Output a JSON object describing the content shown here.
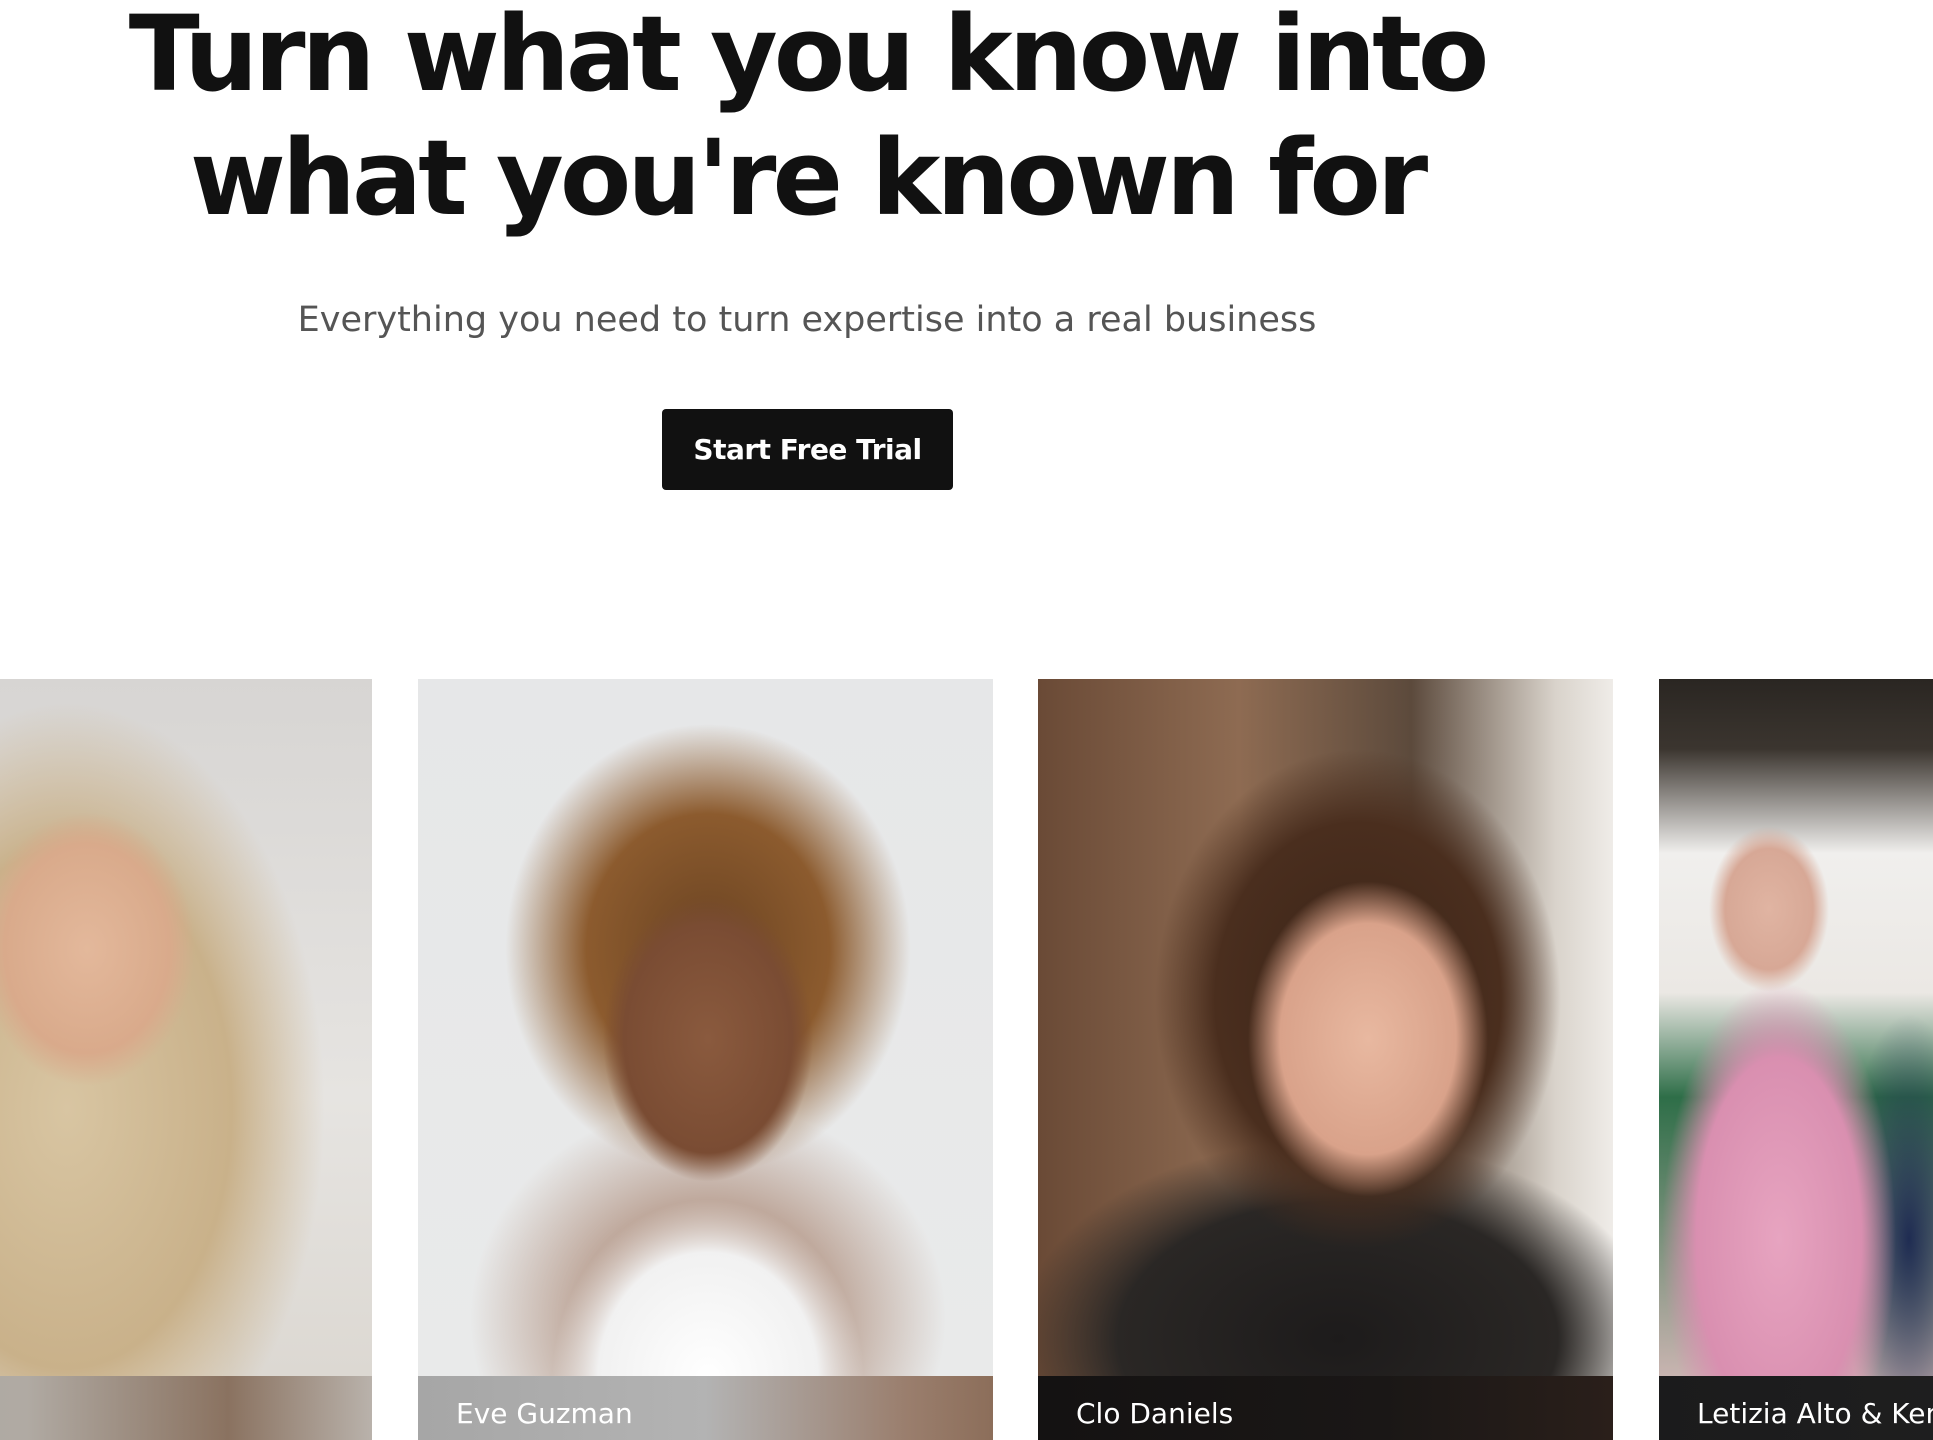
{
  "hero": {
    "title_line_1": "Turn what you know into",
    "title_line_2": "what you're known for",
    "subtitle": "Everything you need to turn expertise into a real business",
    "cta_label": "Start Free Trial"
  },
  "creators": [
    {
      "name": ""
    },
    {
      "name": "Eve Guzman"
    },
    {
      "name": "Clo Daniels"
    },
    {
      "name": "Letizia Alto & Ken"
    }
  ],
  "colors": {
    "cta_background": "#111111",
    "title": "#111111",
    "subtitle": "#555555"
  }
}
